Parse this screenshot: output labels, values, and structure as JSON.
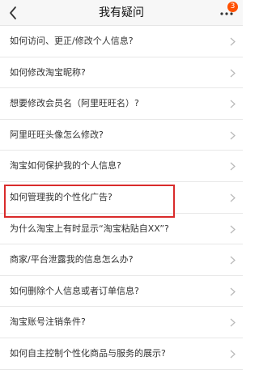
{
  "header": {
    "title": "我有疑问",
    "back_icon": "chevron-left-icon",
    "more_icon": "more-dots-icon",
    "badge_count": "3",
    "badge_color": "#ff5000"
  },
  "questions": [
    "如何访问、更正/修改个人信息?",
    "如何修改淘宝昵称?",
    "想要修改会员名（阿里旺旺名）?",
    "阿里旺旺头像怎么修改?",
    "淘宝如何保护我的个人信息?",
    "如何管理我的个性化广告?",
    "为什么淘宝上有时显示“淘宝粘贴自XX”?",
    "商家/平台泄露我的信息怎么办?",
    "如何删除个人信息或者订单信息?",
    "淘宝账号注销条件?",
    "如何自主控制个性化商品与服务的展示?"
  ],
  "highlight": {
    "row_index": 5,
    "color": "#d92b2b"
  }
}
